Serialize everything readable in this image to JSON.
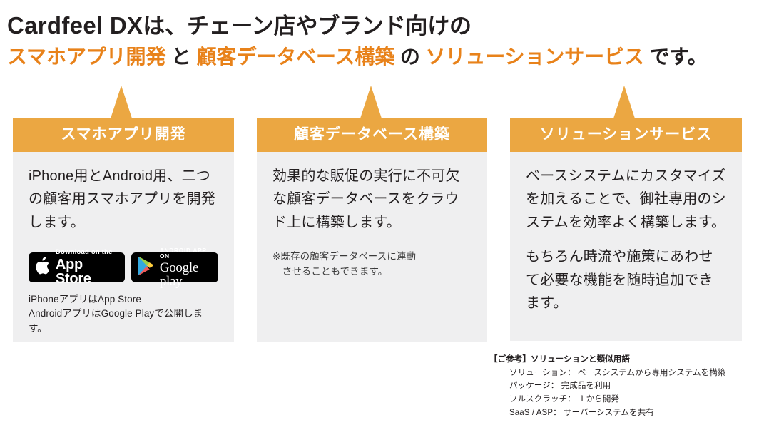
{
  "colors": {
    "accent": "#e8821a",
    "header_bar": "#eba742",
    "card_bg": "#efeff0",
    "text": "#231f20",
    "badge_bg": "#000000"
  },
  "headline": {
    "line1": {
      "brand": "Cardfeel DX",
      "rest": "は、チェーン店やブランド向けの"
    },
    "line2": {
      "term1": "スマホアプリ開発",
      "conj1": " と ",
      "term2": "顧客データベース構築",
      "conj2": " の ",
      "term3": "ソリューションサービス",
      "tail": " です。"
    }
  },
  "cards": [
    {
      "id": "smartphone-app-development",
      "header": "スマホアプリ開発",
      "paragraphs": [
        "iPhone用とAndroid用、二つの顧客用スマホアプリを開発します。"
      ],
      "badges": [
        {
          "id": "app-store",
          "top": "Download on the",
          "main": "App Store"
        },
        {
          "id": "google-play",
          "top": "ANDROID APP ON",
          "main_bold": "Google",
          "main_light": " play"
        }
      ],
      "caption": "iPhoneアプリはApp Store\nAndroidアプリはGoogle Playで公開します。"
    },
    {
      "id": "customer-database-construction",
      "header": "顧客データベース構築",
      "paragraphs": [
        "効果的な販促の実行に不可欠な顧客データベースをクラウド上に構築します。"
      ],
      "note": "※既存の顧客データベースに連動\n　させることもできます。"
    },
    {
      "id": "solution-service",
      "header": "ソリューションサービス",
      "paragraphs": [
        "ベースシステムにカスタマイズを加えることで、御社専用のシステムを効率よく構築します。",
        "もちろん時流や施策にあわせて必要な機能を随時追加できます。"
      ]
    }
  ],
  "reference": {
    "title": "【ご参考】ソリューションと類似用語",
    "items": [
      "ソリューション： ベースシステムから専用システムを構築",
      "パッケージ： 完成品を利用",
      "フルスクラッチ： １から開発",
      "SaaS / ASP： サーバーシステムを共有"
    ]
  }
}
